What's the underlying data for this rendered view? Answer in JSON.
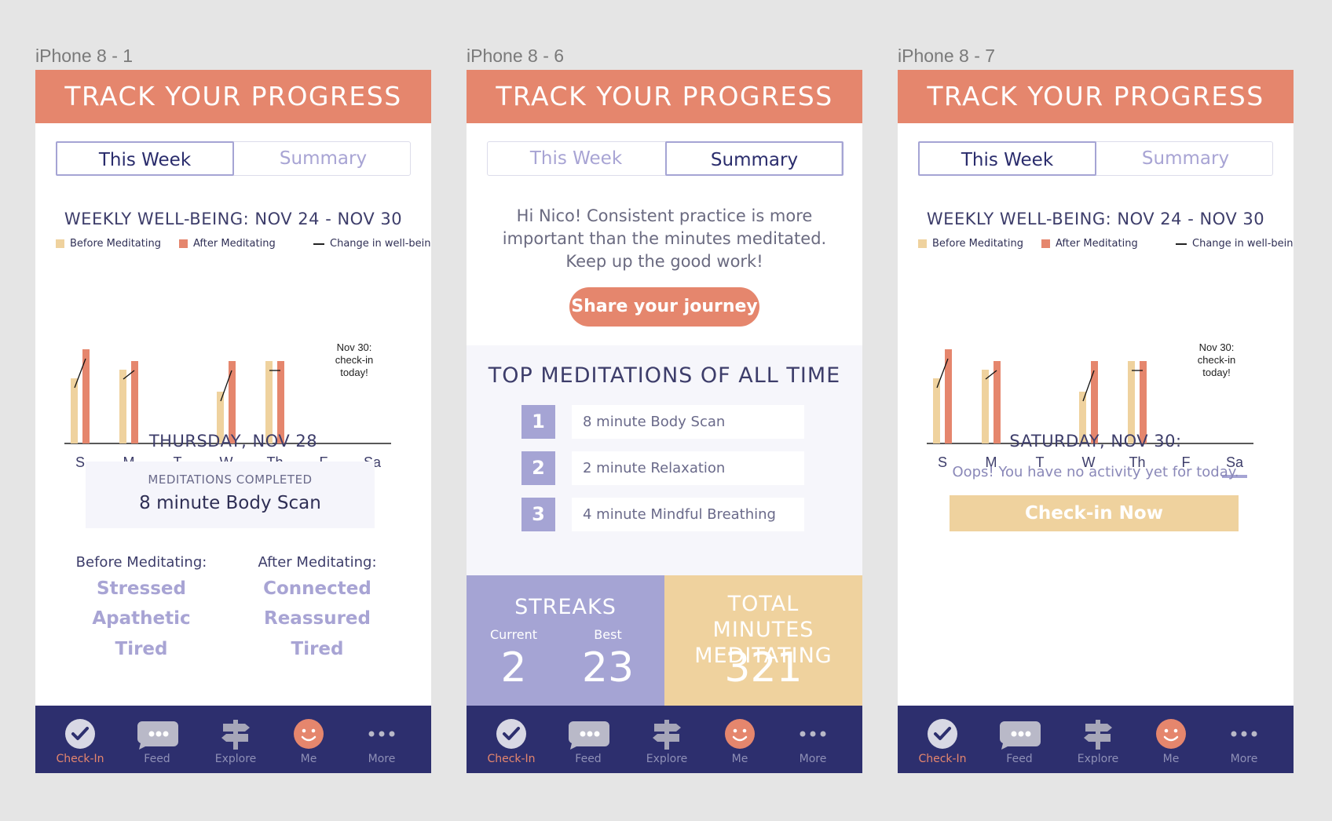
{
  "frames": [
    {
      "label": "iPhone 8 - 1"
    },
    {
      "label": "iPhone 8 - 6"
    },
    {
      "label": "iPhone 8 - 7"
    }
  ],
  "header": {
    "title": "TRACK YOUR PROGRESS"
  },
  "tabs": {
    "this_week": "This Week",
    "summary": "Summary"
  },
  "colors": {
    "header": "#e5866d",
    "nav": "#2d2f6e",
    "purple": "#a5a4d4",
    "before": "#efd29e",
    "after": "#e5866d"
  },
  "chart_data": {
    "type": "bar",
    "title": "WEEKLY WELL-BEING: NOV 24 - NOV 30",
    "categories": [
      "S",
      "M",
      "T",
      "W",
      "Th",
      "F",
      "Sa"
    ],
    "series": [
      {
        "name": "Before Meditating",
        "values": [
          83,
          94,
          null,
          66,
          105,
          null,
          null
        ]
      },
      {
        "name": "After Meditating",
        "values": [
          120,
          105,
          null,
          105,
          105,
          null,
          null
        ]
      }
    ],
    "legend": [
      "Before Meditating",
      "After Meditating",
      "Change in well-being"
    ],
    "note": "Nov 30: check-in today!",
    "ylim": [
      0,
      125
    ],
    "legend_position": "top"
  },
  "frame1": {
    "selected_day": "Th",
    "day_title": "THURSDAY, NOV 28",
    "completed_label": "MEDITATIONS COMPLETED",
    "completed_value": "8 minute Body Scan",
    "before_label": "Before Meditating:",
    "after_label": "After Meditating:",
    "before_moods": [
      "Stressed",
      "Apathetic",
      "Tired"
    ],
    "after_moods": [
      "Connected",
      "Reassured",
      "Tired"
    ]
  },
  "frame2": {
    "message": "Hi Nico! Consistent practice is more important than the minutes meditated. Keep up the good work!",
    "share_button": "Share your journey",
    "top_title": "TOP MEDITATIONS OF ALL TIME",
    "top_items": [
      {
        "rank": "1",
        "name": "8 minute Body Scan"
      },
      {
        "rank": "2",
        "name": "2 minute Relaxation"
      },
      {
        "rank": "3",
        "name": "4 minute Mindful Breathing"
      }
    ],
    "streaks_title": "STREAKS",
    "current_label": "Current",
    "best_label": "Best",
    "current_value": "2",
    "best_value": "23",
    "total_title": "TOTAL MINUTES MEDITATING",
    "total_value": "321"
  },
  "frame3": {
    "selected_day": "Sa",
    "day_title": "SATURDAY, NOV 30:",
    "message": "Oops! You have no activity yet for today.",
    "checkin_button": "Check-in Now"
  },
  "nav": {
    "items": [
      {
        "label": "Check-In",
        "icon": "check-icon"
      },
      {
        "label": "Feed",
        "icon": "chat-bubble-icon"
      },
      {
        "label": "Explore",
        "icon": "signpost-icon"
      },
      {
        "label": "Me",
        "icon": "smiley-icon"
      },
      {
        "label": "More",
        "icon": "more-dots-icon"
      }
    ]
  }
}
